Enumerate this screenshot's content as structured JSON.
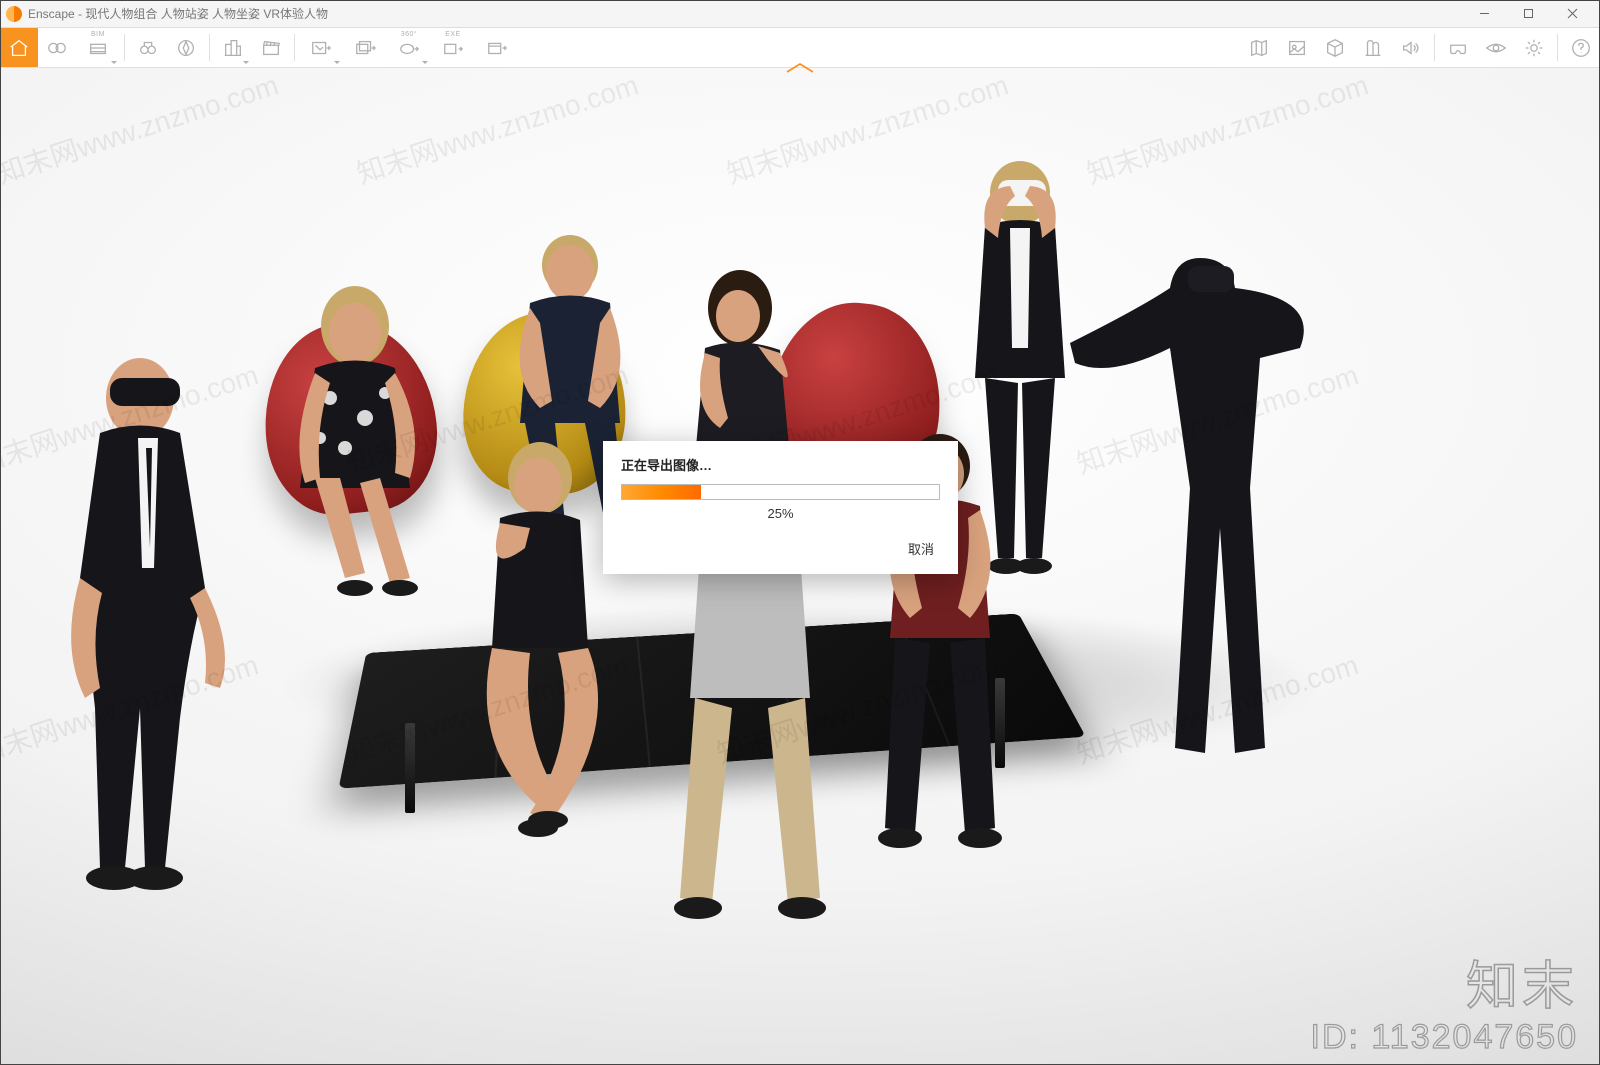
{
  "window": {
    "app_name": "Enscape",
    "title_sep": " - ",
    "document_title": "现代人物组合 人物站姿 人物坐姿 VR体验人物"
  },
  "toolbar_left": {
    "home": "home-icon",
    "sync": "sync-icon",
    "bim_label": "BIM",
    "bim": "bim-views-icon",
    "binoculars": "binoculars-icon",
    "compass": "compass-icon",
    "buildings": "buildings-icon",
    "clapper": "clapperboard-icon",
    "screenshot": "screenshot-export-icon",
    "batch": "batch-export-icon",
    "pano_label": "360°",
    "pano": "panorama-export-icon",
    "exe_label": "EXE",
    "exe": "exe-export-icon",
    "web": "web-export-icon"
  },
  "toolbar_right": {
    "map": "mini-map-icon",
    "assetlib": "asset-library-icon",
    "box": "package-icon",
    "site": "site-context-icon",
    "sound": "sound-icon",
    "vr": "vr-headset-icon",
    "eye": "visual-settings-icon",
    "gear": "settings-icon",
    "help": "help-icon"
  },
  "dialog": {
    "title": "正在导出图像…",
    "percent_value": 25,
    "percent_label": "25%",
    "cancel": "取消"
  },
  "watermark": {
    "text": "知末网www.znzmo.com",
    "brand": "知末",
    "id_label": "ID: 1132047650"
  }
}
